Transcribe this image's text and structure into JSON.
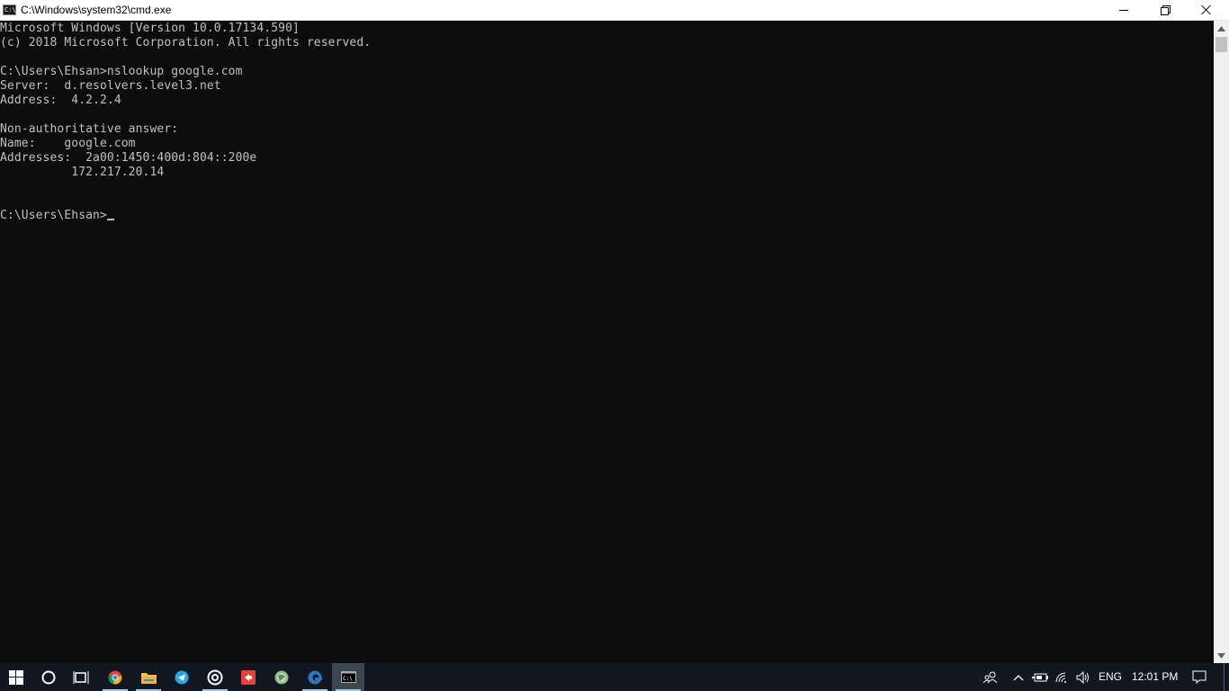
{
  "window": {
    "title": "C:\\Windows\\system32\\cmd.exe",
    "icon_label": "C:\\"
  },
  "console": {
    "lines": [
      "Microsoft Windows [Version 10.0.17134.590]",
      "(c) 2018 Microsoft Corporation. All rights reserved.",
      "",
      "C:\\Users\\Ehsan>nslookup google.com",
      "Server:  d.resolvers.level3.net",
      "Address:  4.2.2.4",
      "",
      "Non-authoritative answer:",
      "Name:    google.com",
      "Addresses:  2a00:1450:400d:804::200e",
      "          172.217.20.14",
      "",
      "",
      "C:\\Users\\Ehsan>"
    ]
  },
  "taskbar": {
    "items": [
      {
        "name": "start-button",
        "icon": "windows-logo-icon"
      },
      {
        "name": "search-button",
        "icon": "cortana-circle-icon"
      },
      {
        "name": "task-view-button",
        "icon": "task-view-icon"
      },
      {
        "name": "chrome-button",
        "icon": "chrome-icon"
      },
      {
        "name": "file-explorer-button",
        "icon": "folder-icon"
      },
      {
        "name": "telegram-button",
        "icon": "telegram-icon"
      },
      {
        "name": "app-button",
        "icon": "circle-app-icon"
      },
      {
        "name": "media-button",
        "icon": "red-app-icon"
      },
      {
        "name": "globe-button",
        "icon": "globe-icon"
      },
      {
        "name": "edge-button",
        "icon": "edge-icon"
      },
      {
        "name": "cmd-button",
        "icon": "cmd-icon"
      }
    ],
    "tray": {
      "language": "ENG",
      "time": "12:01 PM"
    }
  },
  "colors": {
    "console_bg": "#0c0c0c",
    "console_fg": "#c0c0c0",
    "taskbar_bg": "#101720",
    "taskbar_active": "#3c4650"
  }
}
